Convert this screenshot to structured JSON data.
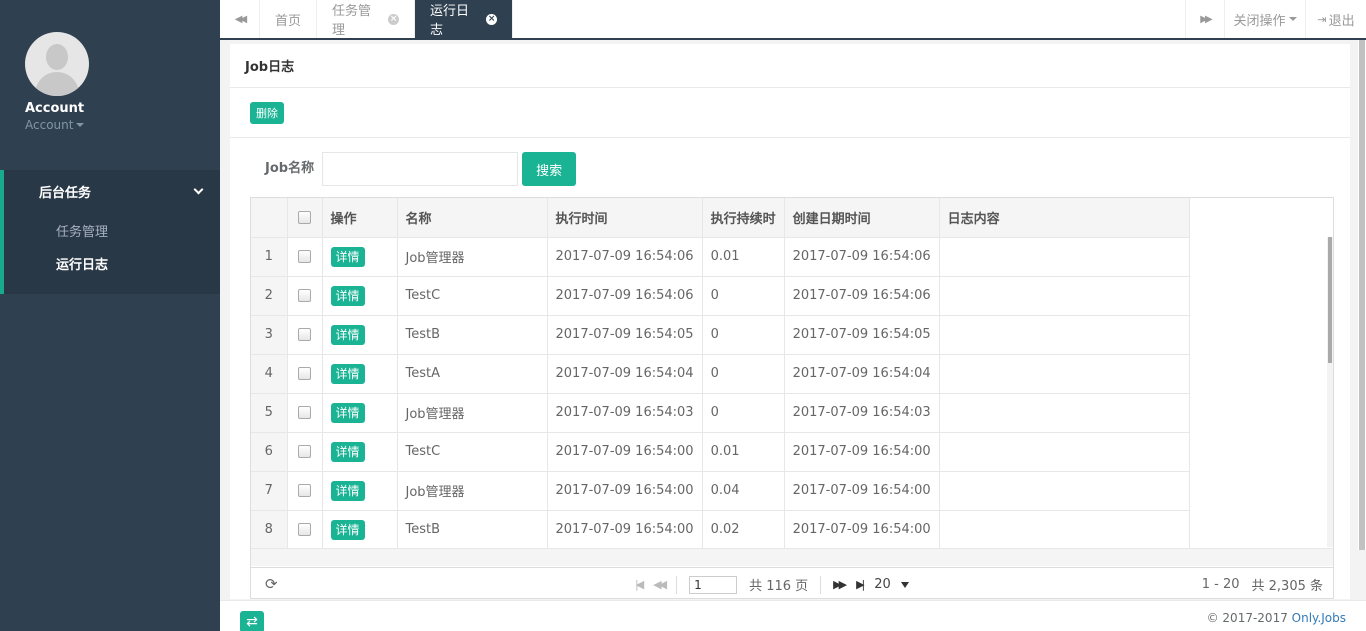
{
  "profile": {
    "name": "Account",
    "role": "Account"
  },
  "nav": {
    "group_label": "后台任务",
    "items": [
      {
        "label": "任务管理",
        "active": false
      },
      {
        "label": "运行日志",
        "active": true
      }
    ]
  },
  "tabs": {
    "items": [
      {
        "label": "首页",
        "closable": false,
        "active": false
      },
      {
        "label": "任务管理",
        "closable": true,
        "active": false
      },
      {
        "label": "运行日志",
        "closable": true,
        "active": true
      }
    ],
    "close_ops_label": "关闭操作",
    "logout_label": "退出"
  },
  "panel": {
    "title": "Job日志",
    "delete_label": "删除",
    "search": {
      "label": "Job名称",
      "value": "",
      "button_label": "搜索"
    }
  },
  "table": {
    "columns": [
      "操作",
      "名称",
      "执行时间",
      "执行持续时",
      "创建日期时间",
      "日志内容"
    ],
    "detail_label": "详情",
    "rows": [
      {
        "index": "1",
        "name": "Job管理器",
        "exec_time": "2017-07-09 16:54:06",
        "duration": "0.01",
        "created": "2017-07-09 16:54:06",
        "content": ""
      },
      {
        "index": "2",
        "name": "TestC",
        "exec_time": "2017-07-09 16:54:06",
        "duration": "0",
        "created": "2017-07-09 16:54:06",
        "content": ""
      },
      {
        "index": "3",
        "name": "TestB",
        "exec_time": "2017-07-09 16:54:05",
        "duration": "0",
        "created": "2017-07-09 16:54:05",
        "content": ""
      },
      {
        "index": "4",
        "name": "TestA",
        "exec_time": "2017-07-09 16:54:04",
        "duration": "0",
        "created": "2017-07-09 16:54:04",
        "content": ""
      },
      {
        "index": "5",
        "name": "Job管理器",
        "exec_time": "2017-07-09 16:54:03",
        "duration": "0",
        "created": "2017-07-09 16:54:03",
        "content": ""
      },
      {
        "index": "6",
        "name": "TestC",
        "exec_time": "2017-07-09 16:54:00",
        "duration": "0.01",
        "created": "2017-07-09 16:54:00",
        "content": ""
      },
      {
        "index": "7",
        "name": "Job管理器",
        "exec_time": "2017-07-09 16:54:00",
        "duration": "0.04",
        "created": "2017-07-09 16:54:00",
        "content": ""
      },
      {
        "index": "8",
        "name": "TestB",
        "exec_time": "2017-07-09 16:54:00",
        "duration": "0.02",
        "created": "2017-07-09 16:54:00",
        "content": ""
      }
    ]
  },
  "pager": {
    "page_value": "1",
    "total_pages_text": "共 116 页",
    "page_size": "20",
    "range_text": "1 - 20",
    "total_text": "共 2,305 条"
  },
  "footer": {
    "copyright": "© 2017-2017 ",
    "brand": "Only.Jobs"
  },
  "colors": {
    "accent": "#1ab394",
    "sidebar": "#2f4050",
    "sidebar_active": "#293846"
  }
}
